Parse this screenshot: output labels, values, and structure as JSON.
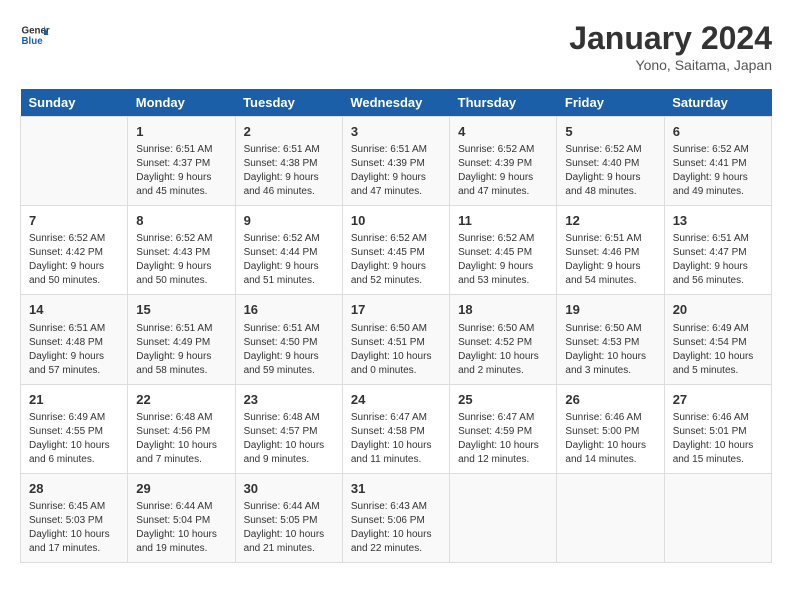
{
  "header": {
    "logo_line1": "General",
    "logo_line2": "Blue",
    "title": "January 2024",
    "subtitle": "Yono, Saitama, Japan"
  },
  "weekdays": [
    "Sunday",
    "Monday",
    "Tuesday",
    "Wednesday",
    "Thursday",
    "Friday",
    "Saturday"
  ],
  "weeks": [
    [
      {
        "day": "",
        "info": ""
      },
      {
        "day": "1",
        "info": "Sunrise: 6:51 AM\nSunset: 4:37 PM\nDaylight: 9 hours\nand 45 minutes."
      },
      {
        "day": "2",
        "info": "Sunrise: 6:51 AM\nSunset: 4:38 PM\nDaylight: 9 hours\nand 46 minutes."
      },
      {
        "day": "3",
        "info": "Sunrise: 6:51 AM\nSunset: 4:39 PM\nDaylight: 9 hours\nand 47 minutes."
      },
      {
        "day": "4",
        "info": "Sunrise: 6:52 AM\nSunset: 4:39 PM\nDaylight: 9 hours\nand 47 minutes."
      },
      {
        "day": "5",
        "info": "Sunrise: 6:52 AM\nSunset: 4:40 PM\nDaylight: 9 hours\nand 48 minutes."
      },
      {
        "day": "6",
        "info": "Sunrise: 6:52 AM\nSunset: 4:41 PM\nDaylight: 9 hours\nand 49 minutes."
      }
    ],
    [
      {
        "day": "7",
        "info": "Sunrise: 6:52 AM\nSunset: 4:42 PM\nDaylight: 9 hours\nand 50 minutes."
      },
      {
        "day": "8",
        "info": "Sunrise: 6:52 AM\nSunset: 4:43 PM\nDaylight: 9 hours\nand 50 minutes."
      },
      {
        "day": "9",
        "info": "Sunrise: 6:52 AM\nSunset: 4:44 PM\nDaylight: 9 hours\nand 51 minutes."
      },
      {
        "day": "10",
        "info": "Sunrise: 6:52 AM\nSunset: 4:45 PM\nDaylight: 9 hours\nand 52 minutes."
      },
      {
        "day": "11",
        "info": "Sunrise: 6:52 AM\nSunset: 4:45 PM\nDaylight: 9 hours\nand 53 minutes."
      },
      {
        "day": "12",
        "info": "Sunrise: 6:51 AM\nSunset: 4:46 PM\nDaylight: 9 hours\nand 54 minutes."
      },
      {
        "day": "13",
        "info": "Sunrise: 6:51 AM\nSunset: 4:47 PM\nDaylight: 9 hours\nand 56 minutes."
      }
    ],
    [
      {
        "day": "14",
        "info": "Sunrise: 6:51 AM\nSunset: 4:48 PM\nDaylight: 9 hours\nand 57 minutes."
      },
      {
        "day": "15",
        "info": "Sunrise: 6:51 AM\nSunset: 4:49 PM\nDaylight: 9 hours\nand 58 minutes."
      },
      {
        "day": "16",
        "info": "Sunrise: 6:51 AM\nSunset: 4:50 PM\nDaylight: 9 hours\nand 59 minutes."
      },
      {
        "day": "17",
        "info": "Sunrise: 6:50 AM\nSunset: 4:51 PM\nDaylight: 10 hours\nand 0 minutes."
      },
      {
        "day": "18",
        "info": "Sunrise: 6:50 AM\nSunset: 4:52 PM\nDaylight: 10 hours\nand 2 minutes."
      },
      {
        "day": "19",
        "info": "Sunrise: 6:50 AM\nSunset: 4:53 PM\nDaylight: 10 hours\nand 3 minutes."
      },
      {
        "day": "20",
        "info": "Sunrise: 6:49 AM\nSunset: 4:54 PM\nDaylight: 10 hours\nand 5 minutes."
      }
    ],
    [
      {
        "day": "21",
        "info": "Sunrise: 6:49 AM\nSunset: 4:55 PM\nDaylight: 10 hours\nand 6 minutes."
      },
      {
        "day": "22",
        "info": "Sunrise: 6:48 AM\nSunset: 4:56 PM\nDaylight: 10 hours\nand 7 minutes."
      },
      {
        "day": "23",
        "info": "Sunrise: 6:48 AM\nSunset: 4:57 PM\nDaylight: 10 hours\nand 9 minutes."
      },
      {
        "day": "24",
        "info": "Sunrise: 6:47 AM\nSunset: 4:58 PM\nDaylight: 10 hours\nand 11 minutes."
      },
      {
        "day": "25",
        "info": "Sunrise: 6:47 AM\nSunset: 4:59 PM\nDaylight: 10 hours\nand 12 minutes."
      },
      {
        "day": "26",
        "info": "Sunrise: 6:46 AM\nSunset: 5:00 PM\nDaylight: 10 hours\nand 14 minutes."
      },
      {
        "day": "27",
        "info": "Sunrise: 6:46 AM\nSunset: 5:01 PM\nDaylight: 10 hours\nand 15 minutes."
      }
    ],
    [
      {
        "day": "28",
        "info": "Sunrise: 6:45 AM\nSunset: 5:03 PM\nDaylight: 10 hours\nand 17 minutes."
      },
      {
        "day": "29",
        "info": "Sunrise: 6:44 AM\nSunset: 5:04 PM\nDaylight: 10 hours\nand 19 minutes."
      },
      {
        "day": "30",
        "info": "Sunrise: 6:44 AM\nSunset: 5:05 PM\nDaylight: 10 hours\nand 21 minutes."
      },
      {
        "day": "31",
        "info": "Sunrise: 6:43 AM\nSunset: 5:06 PM\nDaylight: 10 hours\nand 22 minutes."
      },
      {
        "day": "",
        "info": ""
      },
      {
        "day": "",
        "info": ""
      },
      {
        "day": "",
        "info": ""
      }
    ]
  ]
}
